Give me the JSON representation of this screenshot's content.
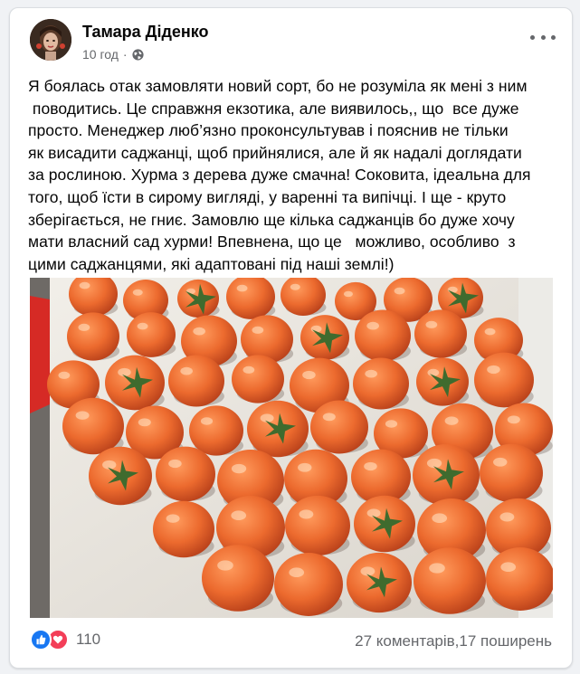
{
  "post": {
    "author": "Тамара Діденко",
    "time": "10 год",
    "privacy_icon": "globe-icon",
    "more_icon": "more-options-icon",
    "text_lines": [
      "Я боялась отак замовляти новий сорт, бо не розуміла як мені з ним",
      " поводитись. Це справжня екзотика, але виявилось,, що  все дуже",
      "просто. Менеджер люб’язно проконсультував і пояснив не тільки",
      "як висадити саджанці, щоб прийнялися, але й як надалі доглядати",
      "за рослиною. Хурма з дерева дуже смачна! Соковита, ідеальна для",
      "того, щоб їсти в сирому вигляді, у варенні та випічці. І ще - круто",
      "зберігається, не гниє. Замовлю ще кілька саджанців бо дуже хочу",
      "мати власний сад хурми! Впевнена, що це   можливо, особливо  з",
      "цими саджанцями, які адаптовані під наші землі!)"
    ],
    "photo_subject": "persimmons"
  },
  "footer": {
    "reaction_icons": [
      "like-icon",
      "love-icon"
    ],
    "reaction_count": "110",
    "comments_shares": "27 коментарів,17 поширень"
  },
  "colors": {
    "like": "#1877f2",
    "love": "#f33e58",
    "secondary_text": "#65676b",
    "fruit": "#e8622a"
  }
}
